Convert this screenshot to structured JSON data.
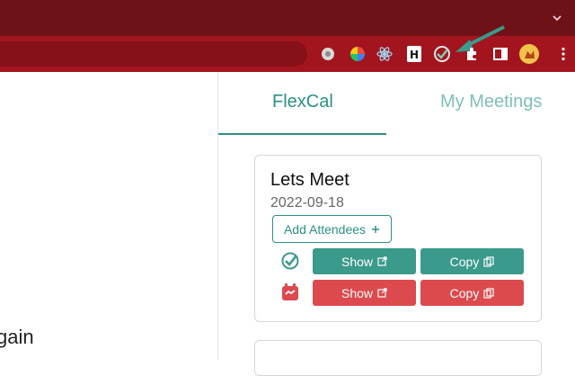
{
  "browser": {
    "extensions": [
      "generic-extension-icon",
      "color-wheel-icon",
      "react-atom-icon",
      "h-letter-icon",
      "flexcal-check-icon",
      "puzzle-extensions-icon",
      "side-panel-icon",
      "profile-avatar-icon"
    ],
    "accent_color": "#a3151e"
  },
  "page": {
    "left_partial_text": "gain"
  },
  "tabs": [
    {
      "label": "FlexCal",
      "active": true
    },
    {
      "label": "My Meetings",
      "active": false
    }
  ],
  "meeting": {
    "title": "Lets Meet",
    "date": "2022-09-18",
    "add_attendees_label": "Add Attendees",
    "rows": [
      {
        "icon": "flexcal-check-icon",
        "show_label": "Show",
        "copy_label": "Copy",
        "color": "#3a9a8b"
      },
      {
        "icon": "calendar-handshake-icon",
        "show_label": "Show",
        "copy_label": "Copy",
        "color": "#dc4a4e"
      }
    ]
  }
}
